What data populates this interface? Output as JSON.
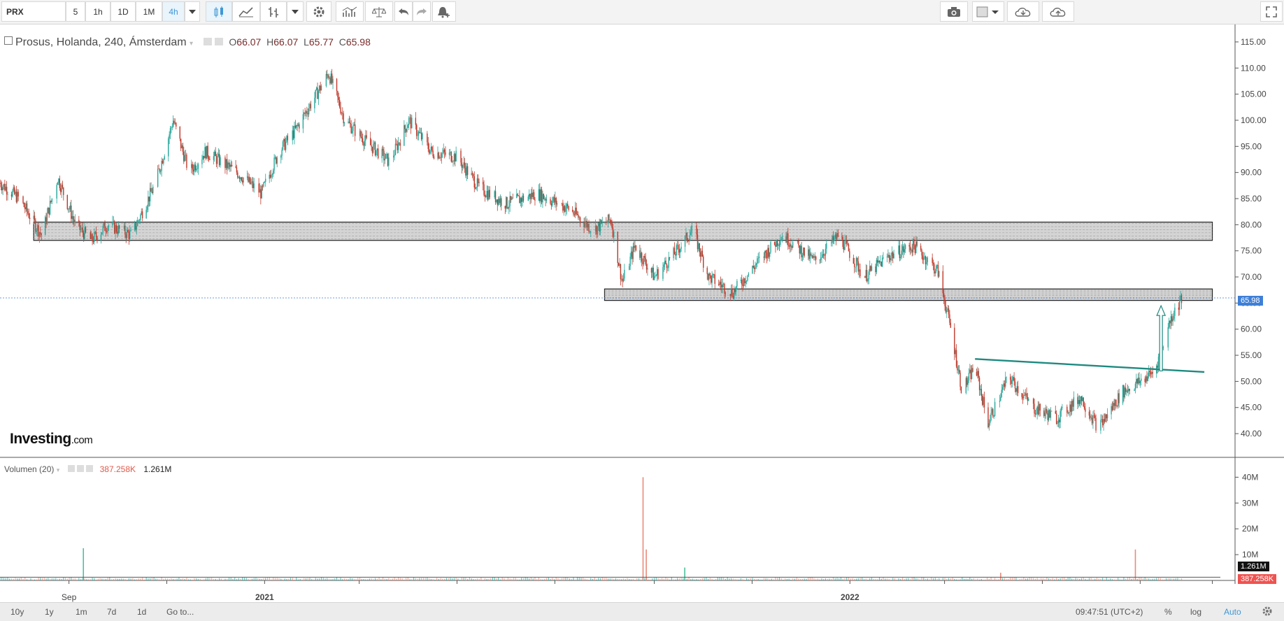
{
  "toolbar": {
    "symbol": "PRX",
    "intervals": [
      "5",
      "1h",
      "1D",
      "1M",
      "4h"
    ],
    "active_interval": "4h"
  },
  "legend": {
    "title": "Prosus, Holanda, 240, Ámsterdam",
    "o_label": "O",
    "o_value": "66.07",
    "h_label": "H",
    "h_value": "66.07",
    "l_label": "L",
    "l_value": "65.77",
    "c_label": "C",
    "c_value": "65.98"
  },
  "watermark": {
    "brand": "Investing",
    "suffix": ".com"
  },
  "volume_legend": {
    "title": "Volumen (20)",
    "value1": "387.258K",
    "value2": "1.261M"
  },
  "price_axis": {
    "ticks": [
      "115.00",
      "110.00",
      "105.00",
      "100.00",
      "95.00",
      "90.00",
      "85.00",
      "80.00",
      "75.00",
      "70.00",
      "65.00",
      "60.00",
      "55.00",
      "50.00",
      "45.00",
      "40.00"
    ],
    "last_price_label": "65.98"
  },
  "volume_axis": {
    "ticks": [
      "40M",
      "30M",
      "20M",
      "10M"
    ],
    "tag1": "1.261M",
    "tag2": "387.258K"
  },
  "time_axis": {
    "labels": [
      "Sep",
      "2021",
      "2022"
    ]
  },
  "bottom_bar": {
    "ranges": [
      "10y",
      "1y",
      "1m",
      "7d",
      "1d"
    ],
    "goto": "Go to...",
    "time": "09:47:51 (UTC+2)",
    "percent": "%",
    "log": "log",
    "auto": "Auto"
  },
  "colors": {
    "up": "#26a69a",
    "down": "#c0392b",
    "trendline": "#1e8a80",
    "last_price_tag": "#3f7fd6",
    "volume_tag": "#ef5350",
    "zone_border": "#222222"
  },
  "chart_data": {
    "type": "candlestick",
    "title": "Prosus, Holanda, 240, Ámsterdam",
    "ylim": [
      38,
      117
    ],
    "price_path": [
      {
        "date": "2020-07-20",
        "price": 88
      },
      {
        "date": "2020-08-01",
        "price": 85
      },
      {
        "date": "2020-08-15",
        "price": 78
      },
      {
        "date": "2020-08-25",
        "price": 89
      },
      {
        "date": "2020-09-05",
        "price": 80
      },
      {
        "date": "2020-09-15",
        "price": 77
      },
      {
        "date": "2020-09-25",
        "price": 80
      },
      {
        "date": "2020-10-10",
        "price": 78
      },
      {
        "date": "2020-10-25",
        "price": 88
      },
      {
        "date": "2020-11-05",
        "price": 100
      },
      {
        "date": "2020-11-15",
        "price": 90
      },
      {
        "date": "2020-11-25",
        "price": 94
      },
      {
        "date": "2020-12-15",
        "price": 90
      },
      {
        "date": "2020-12-30",
        "price": 86
      },
      {
        "date": "2021-01-10",
        "price": 94
      },
      {
        "date": "2021-01-20",
        "price": 98
      },
      {
        "date": "2021-02-10",
        "price": 109
      },
      {
        "date": "2021-02-20",
        "price": 100
      },
      {
        "date": "2021-03-05",
        "price": 96
      },
      {
        "date": "2021-03-20",
        "price": 92
      },
      {
        "date": "2021-04-01",
        "price": 100
      },
      {
        "date": "2021-04-15",
        "price": 94
      },
      {
        "date": "2021-05-01",
        "price": 93
      },
      {
        "date": "2021-05-15",
        "price": 87
      },
      {
        "date": "2021-06-01",
        "price": 84
      },
      {
        "date": "2021-06-20",
        "price": 86
      },
      {
        "date": "2021-07-10",
        "price": 83
      },
      {
        "date": "2021-07-25",
        "price": 79
      },
      {
        "date": "2021-08-05",
        "price": 81
      },
      {
        "date": "2021-08-12",
        "price": 69
      },
      {
        "date": "2021-08-20",
        "price": 76
      },
      {
        "date": "2021-09-01",
        "price": 70
      },
      {
        "date": "2021-09-15",
        "price": 75
      },
      {
        "date": "2021-09-25",
        "price": 79
      },
      {
        "date": "2021-10-05",
        "price": 70
      },
      {
        "date": "2021-10-20",
        "price": 67
      },
      {
        "date": "2021-11-05",
        "price": 73
      },
      {
        "date": "2021-11-20",
        "price": 78
      },
      {
        "date": "2021-12-10",
        "price": 73
      },
      {
        "date": "2021-12-25",
        "price": 78
      },
      {
        "date": "2022-01-10",
        "price": 70
      },
      {
        "date": "2022-01-25",
        "price": 74
      },
      {
        "date": "2022-02-10",
        "price": 76
      },
      {
        "date": "2022-02-25",
        "price": 71
      },
      {
        "date": "2022-03-05",
        "price": 60
      },
      {
        "date": "2022-03-12",
        "price": 48
      },
      {
        "date": "2022-03-20",
        "price": 53
      },
      {
        "date": "2022-03-28",
        "price": 42
      },
      {
        "date": "2022-04-10",
        "price": 51
      },
      {
        "date": "2022-04-25",
        "price": 45
      },
      {
        "date": "2022-05-10",
        "price": 43
      },
      {
        "date": "2022-05-25",
        "price": 47
      },
      {
        "date": "2022-06-05",
        "price": 41
      },
      {
        "date": "2022-06-20",
        "price": 48
      },
      {
        "date": "2022-07-01",
        "price": 50
      },
      {
        "date": "2022-07-10",
        "price": 52
      },
      {
        "date": "2022-07-20",
        "price": 62
      },
      {
        "date": "2022-07-27",
        "price": 66
      }
    ],
    "resistance_zones": [
      {
        "from": "2020-08-10",
        "to": "2022-08-15",
        "low": 77,
        "high": 80.5
      },
      {
        "from": "2021-08-01",
        "to": "2022-08-15",
        "low": 65.5,
        "high": 67.7
      }
    ],
    "trendline": {
      "from_date": "2022-03-20",
      "from_price": 54.3,
      "to_date": "2022-08-10",
      "to_price": 51.8
    },
    "arrow": {
      "date": "2022-07-14",
      "from_price": 52,
      "to_price": 64.5
    },
    "volume_ylim": [
      0,
      42
    ],
    "volume_spikes_millions": [
      {
        "date": "2020-09-10",
        "value": 12.5
      },
      {
        "date": "2021-08-25",
        "value": 40
      },
      {
        "date": "2021-08-27",
        "value": 12
      },
      {
        "date": "2021-09-20",
        "value": 5
      },
      {
        "date": "2022-06-28",
        "value": 12
      },
      {
        "date": "2022-04-05",
        "value": 3
      }
    ],
    "volume_ma_millions": 1.261,
    "last_volume": "387.258K"
  }
}
